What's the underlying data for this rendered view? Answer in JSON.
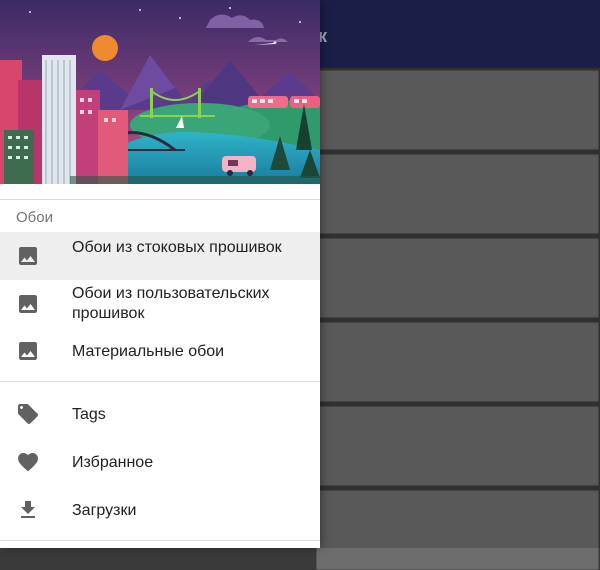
{
  "app_bar": {
    "title_fragment": "к",
    "color": "#222657"
  },
  "drawer": {
    "section_title": "Обои",
    "items": [
      {
        "label": "Обои из стоковых прошивок",
        "icon": "image-icon",
        "active": true
      },
      {
        "label": "Обои из пользовательских прошивок",
        "icon": "image-icon",
        "active": false
      },
      {
        "label": "Материальные обои",
        "icon": "image-icon",
        "active": false
      },
      {
        "label": "Tags",
        "icon": "tag-icon",
        "active": false
      },
      {
        "label": "Избранное",
        "icon": "heart-icon",
        "active": false
      },
      {
        "label": "Загрузки",
        "icon": "download-icon",
        "active": false
      }
    ]
  },
  "colors": {
    "icon": "#616161",
    "text": "#212121",
    "section": "#757575",
    "active_bg": "#eeeeee",
    "card": "#6d6d6d"
  }
}
